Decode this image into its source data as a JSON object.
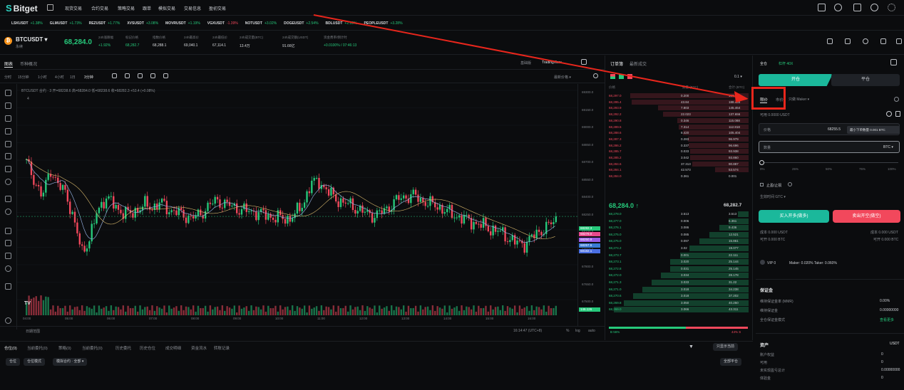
{
  "topnav": {
    "logo": "Bitget",
    "items": [
      "现货交易",
      "合约交易",
      "策略交易",
      "跟单",
      "模拟交易",
      "交易信息",
      "盈初交易"
    ]
  },
  "ticker": [
    {
      "sym": "LSKUSDT",
      "chg": "+1.38%",
      "neg": false
    },
    {
      "sym": "GLMUSDT",
      "chg": "+1.73%",
      "neg": false
    },
    {
      "sym": "REZUSDT",
      "chg": "+1.77%",
      "neg": false
    },
    {
      "sym": "XVSUSDT",
      "chg": "+3.08%",
      "neg": false
    },
    {
      "sym": "MOVRUSDT",
      "chg": "+1.19%",
      "neg": false
    },
    {
      "sym": "VGXUSDT",
      "chg": "-1.39%",
      "neg": true
    },
    {
      "sym": "NOTUSDT",
      "chg": "+3.02%",
      "neg": false
    },
    {
      "sym": "DOGEUSDT",
      "chg": "+2.54%",
      "neg": false
    },
    {
      "sym": "BDLUSDT",
      "chg": "+2.28%",
      "neg": false
    },
    {
      "sym": "PEOPLEUSDT",
      "chg": "+3.28%",
      "neg": false
    }
  ],
  "pair": {
    "name": "BTCUSDT",
    "sub": "永续",
    "last_price": "68,284.0",
    "stats": [
      {
        "label": "24h涨跌幅",
        "value": "+1.92%",
        "color": "green"
      },
      {
        "label": "标记价格",
        "value": "68,282.7",
        "color": "green"
      },
      {
        "label": "指数价格",
        "value": "68,288.1",
        "color": "white"
      },
      {
        "label": "24h最高价",
        "value": "69,040.1",
        "color": "white"
      },
      {
        "label": "24h最低价",
        "value": "67,114.1",
        "color": "white"
      },
      {
        "label": "24h成交量(BTC)",
        "value": "13.4万",
        "color": "white"
      },
      {
        "label": "24h成交额(USDT)",
        "value": "91.66亿",
        "color": "white"
      },
      {
        "label": "资金费率/倒计时",
        "value": "+0.0100% / 07:46:13",
        "color": "green"
      }
    ]
  },
  "chart_tabs": {
    "left": [
      "图表",
      "币种概况"
    ],
    "right": [
      "基础版",
      "TradingView"
    ]
  },
  "timeframes": [
    "分时",
    "15分钟",
    "1小时",
    "4小时",
    "1日",
    "1周",
    "1月",
    "3分钟"
  ],
  "chart_legend": "BTCUSDT 合约 · 3  开=68238.6  高=68284.0  低=68238.6  收=68282.3  +53.4 (+0.08%)",
  "chart_legend_sub": "4",
  "price_dropdown": "最新价格",
  "price_axis": [
    "69300.0",
    "69150.0",
    "69000.0",
    "68850.0",
    "68700.0",
    "68550.0",
    "68400.0",
    "68250.0",
    "68100.0",
    "67950.0",
    "67800.0",
    "67650.0",
    "67500.0"
  ],
  "price_tags": [
    {
      "v": "68282.3",
      "color": "#26c97b"
    },
    {
      "v": "68278.0",
      "color": "#e84a8c"
    },
    {
      "v": "68250.9",
      "color": "#9b5de5"
    },
    {
      "v": "68257.6",
      "color": "#3a7bd5"
    },
    {
      "v": "68182.1",
      "color": "#4a6fe3"
    }
  ],
  "volume_tag": "146.126",
  "time_axis": [
    "04:00",
    "05:00",
    "06:00",
    "07:00",
    "08:00",
    "09:00",
    "10:00",
    "11:00",
    "12:00",
    "13:00",
    "14:00",
    "15:00",
    "16:00"
  ],
  "chart_footer": {
    "range": "日期范围",
    "clock": "16:14:47 (UTC+8)",
    "pct": "%",
    "log": "log",
    "auto": "auto"
  },
  "bottom_tabs": [
    "仓位(0)",
    "当前委托(0)",
    "策略(0)",
    "当前委托(0)",
    "历史委托",
    "历史仓位",
    "成交明细",
    "资金流水",
    "转账记录"
  ],
  "bottom_chips": [
    "仓位",
    "仓位模式",
    "模拟合约 · 全部"
  ],
  "bottom_right": {
    "filter": "只显示当前",
    "closeall": "全部平仓"
  },
  "orderbook": {
    "tabs": [
      "订单簿",
      "最新成交"
    ],
    "precision": "0.1",
    "headers": [
      "价格",
      "数量 (BTC)",
      "合计 (BTC)"
    ],
    "asks": [
      {
        "p": "68,297.0",
        "q": "0.200",
        "t": "190.551"
      },
      {
        "p": "68,295.4",
        "q": "43.84",
        "t": "188.434"
      },
      {
        "p": "68,293.9",
        "q": "7.803",
        "t": "145.464"
      },
      {
        "p": "68,292.2",
        "q": "22.023",
        "t": "137.656"
      },
      {
        "p": "68,290.8",
        "q": "0.346",
        "t": "115.088"
      },
      {
        "p": "68,289.5",
        "q": "7.314",
        "t": "112.818"
      },
      {
        "p": "68,288.6",
        "q": "8.420",
        "t": "105.404"
      },
      {
        "p": "68,287.3",
        "q": "0.283",
        "t": "96.979"
      },
      {
        "p": "68,286.2",
        "q": "0.337",
        "t": "96.696"
      },
      {
        "p": "68,285.7",
        "q": "0.033",
        "t": "93.938"
      },
      {
        "p": "68,285.2",
        "q": "3.042",
        "t": "93.860"
      },
      {
        "p": "68,284.6",
        "q": "37.313",
        "t": "90.887"
      },
      {
        "p": "68,284.1",
        "q": "42.573",
        "t": "53.574"
      },
      {
        "p": "68,284.0",
        "q": "0.361",
        "t": "0.001"
      }
    ],
    "mid": "68,284.0",
    "mid_arrow": "↑",
    "mark": "68,282.7",
    "bids": [
      {
        "p": "68,278.0",
        "q": "3.513",
        "t": "3.513"
      },
      {
        "p": "68,277.0",
        "q": "0.006",
        "t": "6.361"
      },
      {
        "p": "68,276.1",
        "q": "3.086",
        "t": "9.436"
      },
      {
        "p": "68,275.0",
        "q": "0.085",
        "t": "12.521"
      },
      {
        "p": "68,275.0",
        "q": "0.097",
        "t": "15.861"
      },
      {
        "p": "68,274.2",
        "q": "3.02",
        "t": "19.077"
      },
      {
        "p": "68,273.7",
        "q": "0.001",
        "t": "22.111"
      },
      {
        "p": "68,273.1",
        "q": "3.020",
        "t": "25.144"
      },
      {
        "p": "68,272.8",
        "q": "0.031",
        "t": "25.145"
      },
      {
        "p": "68,272.0",
        "q": "3.034",
        "t": "28.178"
      },
      {
        "p": "68,271.3",
        "q": "3.033",
        "t": "31.22"
      },
      {
        "p": "68,271.0",
        "q": "3.018",
        "t": "34.238"
      },
      {
        "p": "68,270.6",
        "q": "3.018",
        "t": "37.202"
      },
      {
        "p": "68,269.8",
        "q": "3.050",
        "t": "40.250"
      },
      {
        "p": "68,269.0",
        "q": "3.066",
        "t": "43.311"
      }
    ],
    "ratio_buy": "B 56%",
    "ratio_sell": "44% S"
  },
  "trade": {
    "mode": "全仓",
    "leverage": "杠杆 40X",
    "open": "开仓",
    "close": "平仓",
    "limit": "限价",
    "market": "市价",
    "maker": "只做 Maker",
    "avail": "可用 0.0000 USDT",
    "price_label": "价格",
    "price_value": "68255.5",
    "tooltip": "最小下单数量 0.001 BTC",
    "qty_label": "数量",
    "qty_unit": "BTC",
    "pcts": [
      "0%",
      "25%",
      "50%",
      "75%",
      "100%"
    ],
    "tpsl": "止盈/止损",
    "effective": "生效时间 GTC",
    "long": "买入开多(做多)",
    "short": "卖出开空(做空)",
    "cost_l": "成本 0.000 USDT",
    "cost_r": "成本 0.000 USDT",
    "max_l": "可开 0.000 BTC",
    "max_r": "可开 0.000 BTC",
    "vip": "VIP 0",
    "fees": "Maker: 0.020%  Taker: 0.060%",
    "margin_title": "保证金",
    "margin_rows": [
      {
        "l": "维持保证金率 (MMR)",
        "v": "0.00%"
      },
      {
        "l": "维持保证金",
        "v": "0.00000000"
      },
      {
        "l": "全仓保证金模式",
        "v": "查看更多"
      }
    ],
    "assets_title": "资产",
    "assets_unit": "USDT",
    "asset_rows": [
      {
        "l": "账户权益",
        "v": "0"
      },
      {
        "l": "可用",
        "v": "0"
      },
      {
        "l": "未实现盈亏总计",
        "v": "0.00000000"
      },
      {
        "l": "体验金",
        "v": "0"
      }
    ]
  },
  "colors": {
    "up": "#26c97b",
    "down": "#f2485c",
    "accent": "#1bb89b",
    "highlight": "#e8261c"
  },
  "chart_data": {
    "type": "candlestick",
    "y_range": [
      67500,
      69300
    ],
    "candles_note": "synthetic visual reconstruction of price path",
    "price_path": [
      68700,
      68550,
      68400,
      68650,
      68500,
      68450,
      68200,
      67950,
      68050,
      68300,
      68400,
      68350,
      68280,
      68260,
      68300,
      68340,
      68320,
      68360,
      68300,
      68280,
      68250,
      68230,
      68260,
      68330,
      68380,
      68350,
      68330,
      68300,
      68290,
      68280,
      68260,
      68240,
      68230,
      68220,
      68260,
      68350,
      68520,
      68540,
      68460,
      68400,
      68360,
      68340,
      68300,
      68270,
      68250,
      68280,
      68330,
      68390,
      68410,
      68420,
      68380,
      68350,
      68330,
      68290,
      68260,
      68230,
      68210,
      68180,
      68160,
      68130,
      68110,
      68060,
      68020,
      68010,
      68070,
      68120,
      68160,
      68220
    ]
  }
}
